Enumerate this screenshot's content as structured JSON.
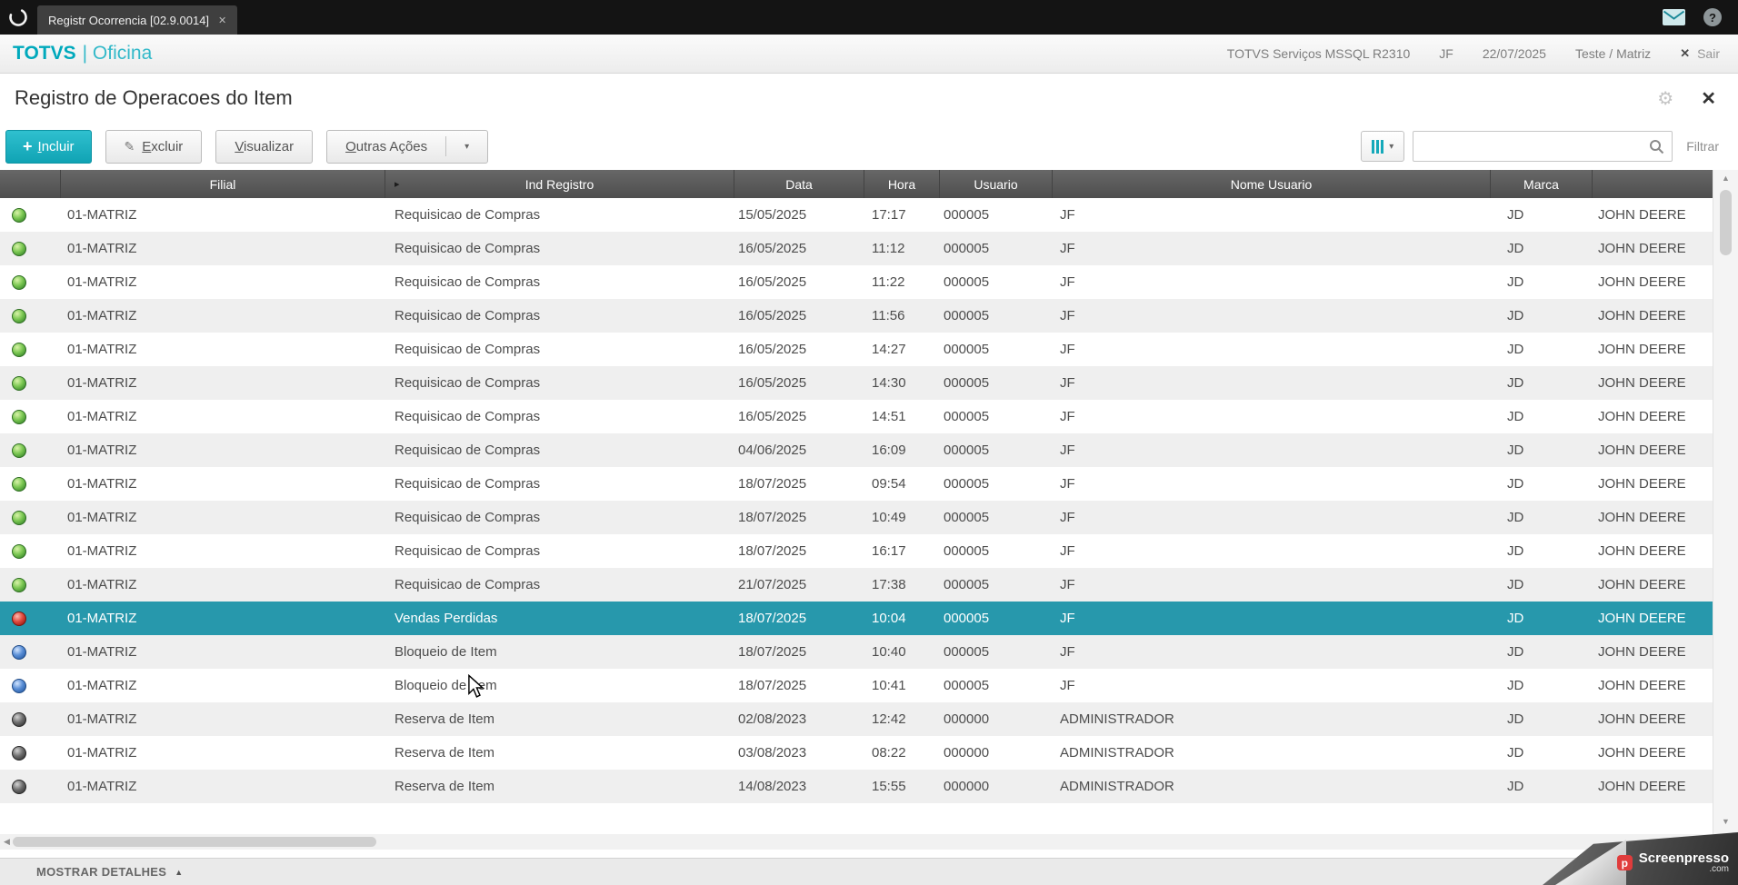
{
  "glyphs": {
    "plus": "+",
    "pencil": "✎",
    "caret_down": "▾",
    "gear": "⚙",
    "close": "✕",
    "tab_close": "✕",
    "sair_x": "✕",
    "help": "?",
    "sort_marker": "▸",
    "scroll_up": "▲",
    "scroll_down": "▼",
    "scroll_left": "◀",
    "scroll_right": "▶",
    "footer_caret": "▲"
  },
  "colors": {
    "accent_teal": "#11a7b8",
    "selected_row": "#2798ac",
    "grid_header": "#585858",
    "status_green": "#6fbf44",
    "status_red": "#d8453a",
    "status_blue": "#4a7fc1",
    "status_dark": "#565656"
  },
  "top_bar": {
    "tab_label": "Registr Ocorrencia [02.9.0014]"
  },
  "app_header": {
    "brand_bold": "TOTVS",
    "brand_rest": "| Oficina",
    "environment": "TOTVS Serviços MSSQL R2310",
    "user": "JF",
    "date": "22/07/2025",
    "branch": "Teste / Matriz",
    "logout_label": "Sair"
  },
  "page": {
    "title": "Registro de Operacoes do Item"
  },
  "toolbar": {
    "incluir_label": "Incluir",
    "excluir_label": "Excluir",
    "visualizar_label": "Visualizar",
    "outras_acoes_label": "Outras Ações",
    "filtrar_label": "Filtrar",
    "search_value": ""
  },
  "table": {
    "columns": [
      "",
      "Filial",
      "Ind Registro",
      "Data",
      "Hora",
      "Usuario",
      "Nome Usuario",
      "Marca",
      ""
    ],
    "rows": [
      {
        "status": "green",
        "filial": "01-MATRIZ",
        "ind_registro": "Requisicao de Compras",
        "data": "15/05/2025",
        "hora": "17:17",
        "usuario": "000005",
        "nome_usuario": "JF",
        "marca": "JD",
        "marca_desc": "JOHN DEERE",
        "selected": false
      },
      {
        "status": "green",
        "filial": "01-MATRIZ",
        "ind_registro": "Requisicao de Compras",
        "data": "16/05/2025",
        "hora": "11:12",
        "usuario": "000005",
        "nome_usuario": "JF",
        "marca": "JD",
        "marca_desc": "JOHN DEERE",
        "selected": false
      },
      {
        "status": "green",
        "filial": "01-MATRIZ",
        "ind_registro": "Requisicao de Compras",
        "data": "16/05/2025",
        "hora": "11:22",
        "usuario": "000005",
        "nome_usuario": "JF",
        "marca": "JD",
        "marca_desc": "JOHN DEERE",
        "selected": false
      },
      {
        "status": "green",
        "filial": "01-MATRIZ",
        "ind_registro": "Requisicao de Compras",
        "data": "16/05/2025",
        "hora": "11:56",
        "usuario": "000005",
        "nome_usuario": "JF",
        "marca": "JD",
        "marca_desc": "JOHN DEERE",
        "selected": false
      },
      {
        "status": "green",
        "filial": "01-MATRIZ",
        "ind_registro": "Requisicao de Compras",
        "data": "16/05/2025",
        "hora": "14:27",
        "usuario": "000005",
        "nome_usuario": "JF",
        "marca": "JD",
        "marca_desc": "JOHN DEERE",
        "selected": false
      },
      {
        "status": "green",
        "filial": "01-MATRIZ",
        "ind_registro": "Requisicao de Compras",
        "data": "16/05/2025",
        "hora": "14:30",
        "usuario": "000005",
        "nome_usuario": "JF",
        "marca": "JD",
        "marca_desc": "JOHN DEERE",
        "selected": false
      },
      {
        "status": "green",
        "filial": "01-MATRIZ",
        "ind_registro": "Requisicao de Compras",
        "data": "16/05/2025",
        "hora": "14:51",
        "usuario": "000005",
        "nome_usuario": "JF",
        "marca": "JD",
        "marca_desc": "JOHN DEERE",
        "selected": false
      },
      {
        "status": "green",
        "filial": "01-MATRIZ",
        "ind_registro": "Requisicao de Compras",
        "data": "04/06/2025",
        "hora": "16:09",
        "usuario": "000005",
        "nome_usuario": "JF",
        "marca": "JD",
        "marca_desc": "JOHN DEERE",
        "selected": false
      },
      {
        "status": "green",
        "filial": "01-MATRIZ",
        "ind_registro": "Requisicao de Compras",
        "data": "18/07/2025",
        "hora": "09:54",
        "usuario": "000005",
        "nome_usuario": "JF",
        "marca": "JD",
        "marca_desc": "JOHN DEERE",
        "selected": false
      },
      {
        "status": "green",
        "filial": "01-MATRIZ",
        "ind_registro": "Requisicao de Compras",
        "data": "18/07/2025",
        "hora": "10:49",
        "usuario": "000005",
        "nome_usuario": "JF",
        "marca": "JD",
        "marca_desc": "JOHN DEERE",
        "selected": false
      },
      {
        "status": "green",
        "filial": "01-MATRIZ",
        "ind_registro": "Requisicao de Compras",
        "data": "18/07/2025",
        "hora": "16:17",
        "usuario": "000005",
        "nome_usuario": "JF",
        "marca": "JD",
        "marca_desc": "JOHN DEERE",
        "selected": false
      },
      {
        "status": "green",
        "filial": "01-MATRIZ",
        "ind_registro": "Requisicao de Compras",
        "data": "21/07/2025",
        "hora": "17:38",
        "usuario": "000005",
        "nome_usuario": "JF",
        "marca": "JD",
        "marca_desc": "JOHN DEERE",
        "selected": false
      },
      {
        "status": "red",
        "filial": "01-MATRIZ",
        "ind_registro": "Vendas Perdidas",
        "data": "18/07/2025",
        "hora": "10:04",
        "usuario": "000005",
        "nome_usuario": "JF",
        "marca": "JD",
        "marca_desc": "JOHN DEERE",
        "selected": true
      },
      {
        "status": "blue",
        "filial": "01-MATRIZ",
        "ind_registro": "Bloqueio de Item",
        "data": "18/07/2025",
        "hora": "10:40",
        "usuario": "000005",
        "nome_usuario": "JF",
        "marca": "JD",
        "marca_desc": "JOHN DEERE",
        "selected": false
      },
      {
        "status": "blue",
        "filial": "01-MATRIZ",
        "ind_registro": "Bloqueio de Item",
        "data": "18/07/2025",
        "hora": "10:41",
        "usuario": "000005",
        "nome_usuario": "JF",
        "marca": "JD",
        "marca_desc": "JOHN DEERE",
        "selected": false
      },
      {
        "status": "dark",
        "filial": "01-MATRIZ",
        "ind_registro": "Reserva de Item",
        "data": "02/08/2023",
        "hora": "12:42",
        "usuario": "000000",
        "nome_usuario": "ADMINISTRADOR",
        "marca": "JD",
        "marca_desc": "JOHN DEERE",
        "selected": false
      },
      {
        "status": "dark",
        "filial": "01-MATRIZ",
        "ind_registro": "Reserva de Item",
        "data": "03/08/2023",
        "hora": "08:22",
        "usuario": "000000",
        "nome_usuario": "ADMINISTRADOR",
        "marca": "JD",
        "marca_desc": "JOHN DEERE",
        "selected": false
      },
      {
        "status": "dark",
        "filial": "01-MATRIZ",
        "ind_registro": "Reserva de Item",
        "data": "14/08/2023",
        "hora": "15:55",
        "usuario": "000000",
        "nome_usuario": "ADMINISTRADOR",
        "marca": "JD",
        "marca_desc": "JOHN DEERE",
        "selected": false
      }
    ]
  },
  "footer": {
    "label": "MOSTRAR DETALHES"
  },
  "watermark": {
    "text": "Screenpresso",
    "domain": ".com"
  }
}
